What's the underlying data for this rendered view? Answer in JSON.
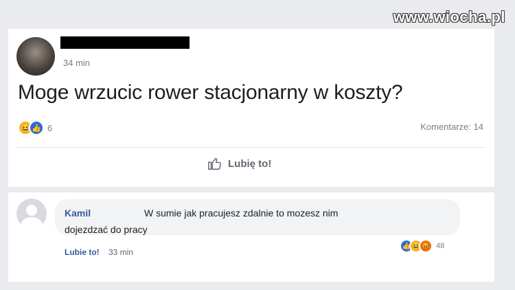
{
  "watermark": "www.wiocha.pl",
  "post": {
    "time": "34 min",
    "text": "Moge wrzucic rower stacjonarny w koszty?",
    "reaction_count": "6",
    "comments": "Komentarze: 14",
    "like_label": "Lubię to!"
  },
  "comment": {
    "author": "Kamil",
    "text_line1": "W sumie jak pracujesz zdalnie to mozesz nim",
    "text_line2": "dojezdzać do pracy",
    "like_label": "Lubie to!",
    "time": "33 min",
    "reaction_count": "48"
  },
  "colors": {
    "like_blue": "#2e6ad8",
    "haha_yellow": "#f7b125",
    "angry_orange": "#e9710f",
    "author_link": "#385898"
  }
}
